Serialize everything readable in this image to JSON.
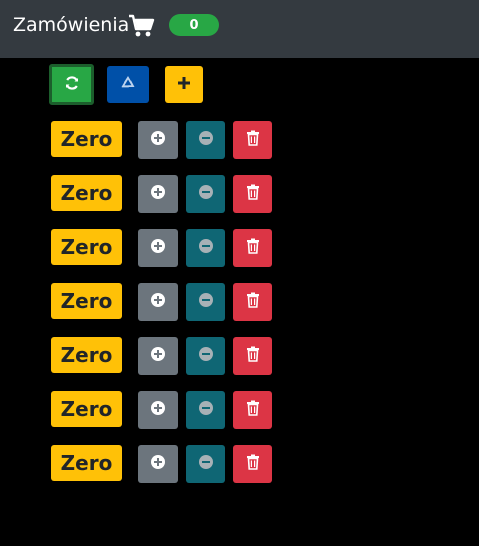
{
  "navbar": {
    "brand": "Zamówienia",
    "cart_icon": "shopping-cart-icon",
    "cart_count": "0"
  },
  "toolbar": {
    "refresh_icon": "refresh-icon",
    "recycle_icon": "recycle-icon",
    "add_label": "+"
  },
  "items": [
    {
      "label": "Zero"
    },
    {
      "label": "Zero"
    },
    {
      "label": "Zero"
    },
    {
      "label": "Zero"
    },
    {
      "label": "Zero"
    },
    {
      "label": "Zero"
    },
    {
      "label": "Zero"
    }
  ],
  "colors": {
    "navbar_bg": "#343a40",
    "success": "#28a745",
    "primary": "#0050a8",
    "warning": "#ffc107",
    "secondary": "#6c757d",
    "info_dark": "#0f6674",
    "danger": "#dc3545"
  }
}
